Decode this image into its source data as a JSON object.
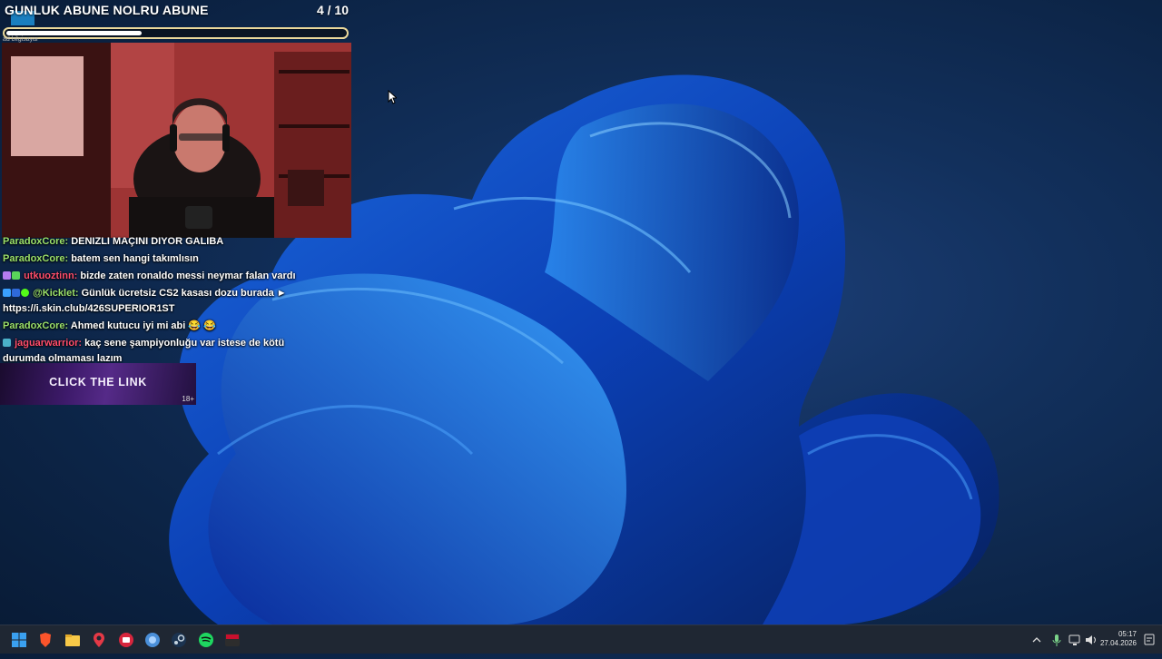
{
  "goal": {
    "title": "GUNLUK ABUNE NOLRU ABUNE",
    "count_text": "4 / 10",
    "progress": 0.4,
    "subtitle": "ad bilgisayar"
  },
  "chat": {
    "messages": [
      {
        "user": "ParadoxCore:",
        "text": "DENIZLI MAÇINI DIYOR GALIBA",
        "color": "green"
      },
      {
        "user": "ParadoxCore:",
        "text": "batem sen hangi takımlısın",
        "color": "green"
      },
      {
        "user": "utkuoztinn:",
        "text": "bizde zaten ronaldo messi neymar falan vardı",
        "color": "red"
      },
      {
        "user": "@Kicklet:",
        "text": "Günlük ücretsiz CS2 kasası dozu burada ►",
        "text2": "https://i.skin.club/426SUPERIOR1ST",
        "color": "purple"
      },
      {
        "user": "ParadoxCore:",
        "text": "Ahmed kutucu iyi mi abi 😂 😂",
        "color": "green"
      },
      {
        "user": "jaguarwarrior:",
        "text": "kaç sene şampiyonluğu var istese de kötü",
        "text2": "durumda olmaması lazım",
        "color": "red"
      }
    ]
  },
  "cta": {
    "label": "CLICK THE LINK",
    "age": "18+"
  },
  "taskbar": {
    "apps": [
      "start-icon",
      "brave-icon",
      "file-explorer-icon",
      "maps-pin-icon",
      "red-app-icon",
      "browser-icon",
      "steam-icon",
      "spotify-icon",
      "tv-app-icon"
    ],
    "time": "05:17",
    "date": "27.04.2026"
  },
  "colors": {
    "user_green": "#9be06a",
    "user_red": "#ff4d6b",
    "taskbar": "#1f2733",
    "goal_border": "#e9d79a"
  }
}
